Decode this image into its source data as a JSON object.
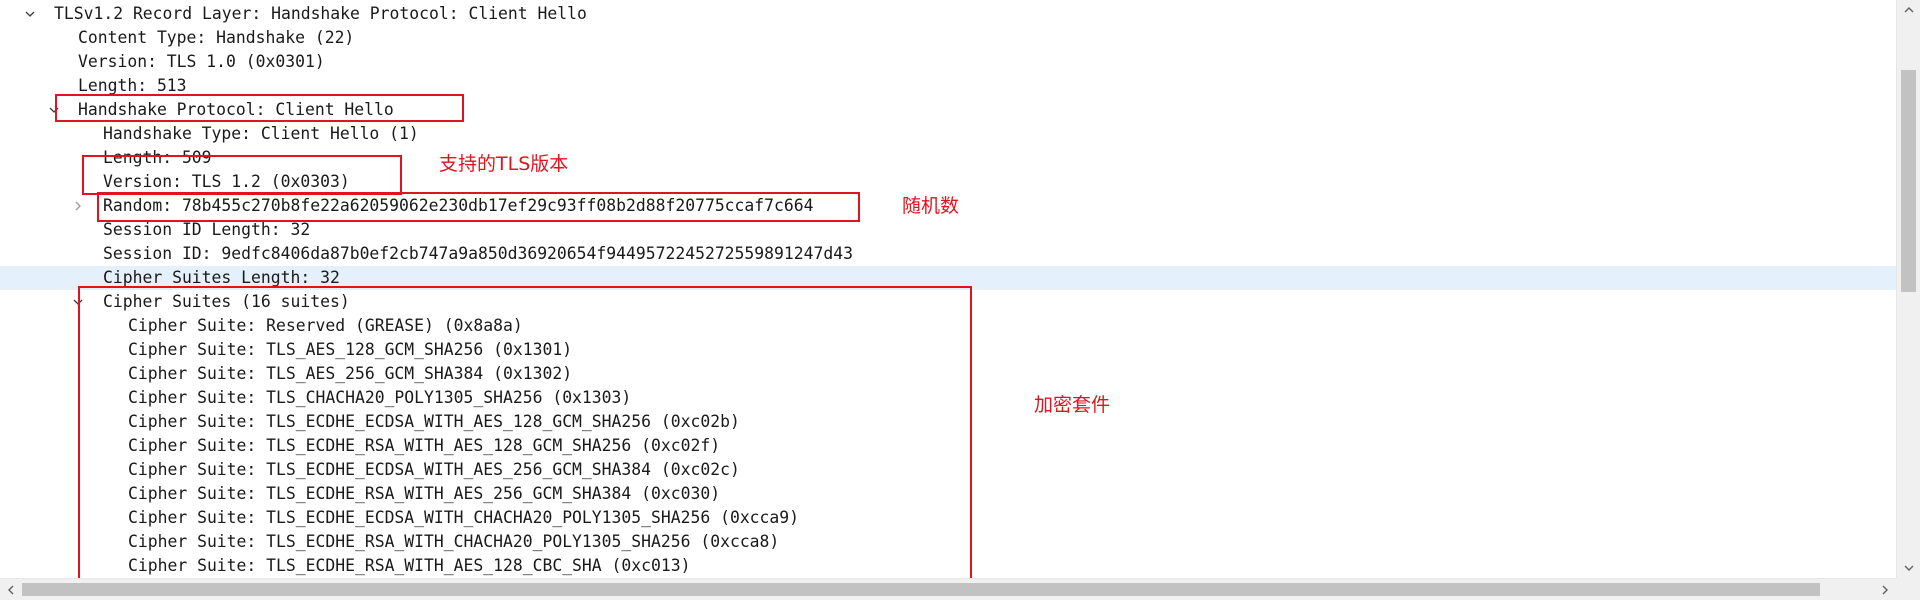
{
  "tree": {
    "rows": [
      {
        "text": "TLSv1.2 Record Layer: Handshake Protocol: Client Hello",
        "level": 0,
        "toggle": "expanded"
      },
      {
        "text": "Content Type: Handshake (22)",
        "level": 1,
        "toggle": "none"
      },
      {
        "text": "Version: TLS 1.0 (0x0301)",
        "level": 1,
        "toggle": "none"
      },
      {
        "text": "Length: 513",
        "level": 1,
        "toggle": "none"
      },
      {
        "text": "Handshake Protocol: Client Hello",
        "level": 1,
        "toggle": "expanded"
      },
      {
        "text": "Handshake Type: Client Hello (1)",
        "level": 2,
        "toggle": "none"
      },
      {
        "text": "Length: 509",
        "level": 2,
        "toggle": "none"
      },
      {
        "text": "Version: TLS 1.2 (0x0303)",
        "level": 2,
        "toggle": "none"
      },
      {
        "text": "Random: 78b455c270b8fe22a62059062e230db17ef29c93ff08b2d88f20775ccaf7c664",
        "level": 2,
        "toggle": "collapsed"
      },
      {
        "text": "Session ID Length: 32",
        "level": 2,
        "toggle": "none"
      },
      {
        "text": "Session ID: 9edfc8406da87b0ef2cb747a9a850d36920654f9449572245272559891247d43",
        "level": 2,
        "toggle": "none"
      },
      {
        "text": "Cipher Suites Length: 32",
        "level": 2,
        "toggle": "none",
        "selected": true
      },
      {
        "text": "Cipher Suites (16 suites)",
        "level": 2,
        "toggle": "expanded"
      },
      {
        "text": "Cipher Suite: Reserved (GREASE) (0x8a8a)",
        "level": 3,
        "toggle": "none"
      },
      {
        "text": "Cipher Suite: TLS_AES_128_GCM_SHA256 (0x1301)",
        "level": 3,
        "toggle": "none"
      },
      {
        "text": "Cipher Suite: TLS_AES_256_GCM_SHA384 (0x1302)",
        "level": 3,
        "toggle": "none"
      },
      {
        "text": "Cipher Suite: TLS_CHACHA20_POLY1305_SHA256 (0x1303)",
        "level": 3,
        "toggle": "none"
      },
      {
        "text": "Cipher Suite: TLS_ECDHE_ECDSA_WITH_AES_128_GCM_SHA256 (0xc02b)",
        "level": 3,
        "toggle": "none"
      },
      {
        "text": "Cipher Suite: TLS_ECDHE_RSA_WITH_AES_128_GCM_SHA256 (0xc02f)",
        "level": 3,
        "toggle": "none"
      },
      {
        "text": "Cipher Suite: TLS_ECDHE_ECDSA_WITH_AES_256_GCM_SHA384 (0xc02c)",
        "level": 3,
        "toggle": "none"
      },
      {
        "text": "Cipher Suite: TLS_ECDHE_RSA_WITH_AES_256_GCM_SHA384 (0xc030)",
        "level": 3,
        "toggle": "none"
      },
      {
        "text": "Cipher Suite: TLS_ECDHE_ECDSA_WITH_CHACHA20_POLY1305_SHA256 (0xcca9)",
        "level": 3,
        "toggle": "none"
      },
      {
        "text": "Cipher Suite: TLS_ECDHE_RSA_WITH_CHACHA20_POLY1305_SHA256 (0xcca8)",
        "level": 3,
        "toggle": "none"
      },
      {
        "text": "Cipher Suite: TLS_ECDHE_RSA_WITH_AES_128_CBC_SHA (0xc013)",
        "level": 3,
        "toggle": "none"
      }
    ]
  },
  "annotations": {
    "tls_version": "支持的TLS版本",
    "random": "随机数",
    "cipher_suites": "加密套件"
  },
  "colors": {
    "annotation": "#e0141e",
    "selected_row": "#e4f0fb",
    "text": "#1a1a1a"
  },
  "icons": {
    "expanded": "chevron-down-icon",
    "collapsed": "chevron-right-icon"
  }
}
